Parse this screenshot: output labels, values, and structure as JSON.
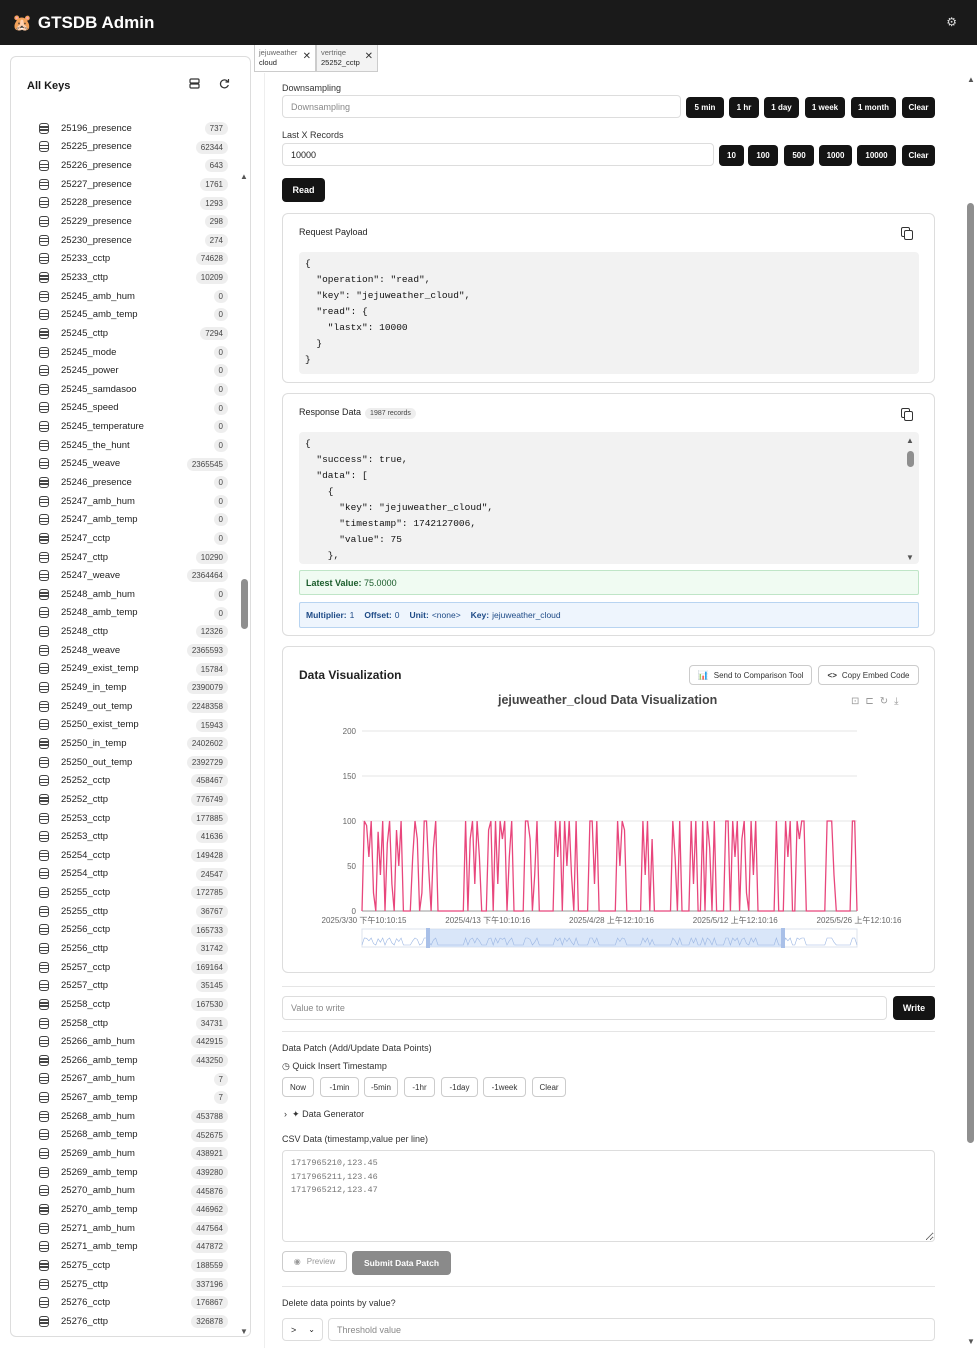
{
  "app": {
    "title": "GTSDB Admin",
    "logo_icon": "hamster-icon",
    "settings_icon": "gear-icon"
  },
  "sidebar": {
    "title": "All Keys",
    "top_partial": "25196_presence",
    "keys": [
      {
        "name": "25196_presence",
        "count": "737"
      },
      {
        "name": "25225_presence",
        "count": "62344"
      },
      {
        "name": "25226_presence",
        "count": "643"
      },
      {
        "name": "25227_presence",
        "count": "1761"
      },
      {
        "name": "25228_presence",
        "count": "1293"
      },
      {
        "name": "25229_presence",
        "count": "298"
      },
      {
        "name": "25230_presence",
        "count": "274"
      },
      {
        "name": "25233_cctp",
        "count": "74628"
      },
      {
        "name": "25233_cttp",
        "count": "10209"
      },
      {
        "name": "25245_amb_hum",
        "count": "0"
      },
      {
        "name": "25245_amb_temp",
        "count": "0"
      },
      {
        "name": "25245_cttp",
        "count": "7294"
      },
      {
        "name": "25245_mode",
        "count": "0"
      },
      {
        "name": "25245_power",
        "count": "0"
      },
      {
        "name": "25245_samdasoo",
        "count": "0"
      },
      {
        "name": "25245_speed",
        "count": "0"
      },
      {
        "name": "25245_temperature",
        "count": "0"
      },
      {
        "name": "25245_the_hunt",
        "count": "0"
      },
      {
        "name": "25245_weave",
        "count": "2365545"
      },
      {
        "name": "25246_presence",
        "count": "0"
      },
      {
        "name": "25247_amb_hum",
        "count": "0"
      },
      {
        "name": "25247_amb_temp",
        "count": "0"
      },
      {
        "name": "25247_cctp",
        "count": "0"
      },
      {
        "name": "25247_cttp",
        "count": "10290"
      },
      {
        "name": "25247_weave",
        "count": "2364464"
      },
      {
        "name": "25248_amb_hum",
        "count": "0"
      },
      {
        "name": "25248_amb_temp",
        "count": "0"
      },
      {
        "name": "25248_cttp",
        "count": "12326"
      },
      {
        "name": "25248_weave",
        "count": "2365593"
      },
      {
        "name": "25249_exist_temp",
        "count": "15784"
      },
      {
        "name": "25249_in_temp",
        "count": "2390079"
      },
      {
        "name": "25249_out_temp",
        "count": "2248358"
      },
      {
        "name": "25250_exist_temp",
        "count": "15943"
      },
      {
        "name": "25250_in_temp",
        "count": "2402602"
      },
      {
        "name": "25250_out_temp",
        "count": "2392729"
      },
      {
        "name": "25252_cctp",
        "count": "458467"
      },
      {
        "name": "25252_cttp",
        "count": "776749"
      },
      {
        "name": "25253_cctp",
        "count": "177885"
      },
      {
        "name": "25253_cttp",
        "count": "41636"
      },
      {
        "name": "25254_cctp",
        "count": "149428"
      },
      {
        "name": "25254_cttp",
        "count": "24547"
      },
      {
        "name": "25255_cctp",
        "count": "172785"
      },
      {
        "name": "25255_cttp",
        "count": "36767"
      },
      {
        "name": "25256_cctp",
        "count": "165733"
      },
      {
        "name": "25256_cttp",
        "count": "31742"
      },
      {
        "name": "25257_cctp",
        "count": "169164"
      },
      {
        "name": "25257_cttp",
        "count": "35145"
      },
      {
        "name": "25258_cctp",
        "count": "167530"
      },
      {
        "name": "25258_cttp",
        "count": "34731"
      },
      {
        "name": "25266_amb_hum",
        "count": "442915"
      },
      {
        "name": "25266_amb_temp",
        "count": "443250"
      },
      {
        "name": "25267_amb_hum",
        "count": "7"
      },
      {
        "name": "25267_amb_temp",
        "count": "7"
      },
      {
        "name": "25268_amb_hum",
        "count": "453788"
      },
      {
        "name": "25268_amb_temp",
        "count": "452675"
      },
      {
        "name": "25269_amb_hum",
        "count": "438921"
      },
      {
        "name": "25269_amb_temp",
        "count": "439280"
      },
      {
        "name": "25270_amb_hum",
        "count": "445876"
      },
      {
        "name": "25270_amb_temp",
        "count": "446962"
      },
      {
        "name": "25271_amb_hum",
        "count": "447564"
      },
      {
        "name": "25271_amb_temp",
        "count": "447872"
      },
      {
        "name": "25275_cctp",
        "count": "188559"
      },
      {
        "name": "25275_cttp",
        "count": "337196"
      },
      {
        "name": "25276_cctp",
        "count": "176867"
      },
      {
        "name": "25276_cttp",
        "count": "326878"
      }
    ]
  },
  "tabs": [
    {
      "line1": "jejuweather",
      "line2": "cloud",
      "close": "✕"
    },
    {
      "line1": "vertriqe",
      "line2": "25252_cctp",
      "close": "✕"
    }
  ],
  "downsampling": {
    "label": "Downsampling",
    "placeholder": "Downsampling",
    "buttons": [
      "5 min",
      "1 hr",
      "1 day",
      "1 week",
      "1 month",
      "Clear"
    ]
  },
  "lastx": {
    "label": "Last X Records",
    "value": "10000",
    "buttons": [
      "10",
      "100",
      "500",
      "1000",
      "10000",
      "Clear"
    ]
  },
  "read_button": "Read",
  "request": {
    "title": "Request Payload",
    "code": "{\n  \"operation\": \"read\",\n  \"key\": \"jejuweather_cloud\",\n  \"read\": {\n    \"lastx\": 10000\n  }\n}"
  },
  "response": {
    "title": "Response Data",
    "badge": "1987 records",
    "code": "{\n  \"success\": true,\n  \"data\": [\n    {\n      \"key\": \"jejuweather_cloud\",\n      \"timestamp\": 1742127006,\n      \"value\": 75\n    },",
    "latest_label": "Latest Value:",
    "latest_value": "75.0000",
    "multiplier_label": "Multiplier:",
    "multiplier_value": "1",
    "offset_label": "Offset:",
    "offset_value": "0",
    "unit_label": "Unit:",
    "unit_value": "<none>",
    "key_label": "Key:",
    "key_value": "jejuweather_cloud"
  },
  "viz": {
    "title": "Data Visualization",
    "send_button": "Send to Comparison Tool",
    "embed_button": "Copy Embed Code"
  },
  "chart_data": {
    "type": "line",
    "title": "jejuweather_cloud Data Visualization",
    "xlabel": "",
    "ylabel": "",
    "ylim": [
      0,
      200
    ],
    "yticks": [
      "0",
      "50",
      "100",
      "150",
      "200"
    ],
    "xticks": [
      "2025/3/30 下午10:10:15",
      "2025/4/13 下午10:10:16",
      "2025/4/28 上午12:10:16",
      "2025/5/12 上午12:10:16",
      "2025/5/26 上午12:10:16"
    ],
    "grid": true,
    "color": "#e8467c",
    "series": [
      {
        "values": [
          0,
          100,
          95,
          60,
          100,
          20,
          0,
          88,
          40,
          100,
          0,
          75,
          100,
          30,
          0,
          90,
          50,
          100,
          0,
          0,
          0,
          0,
          60,
          100,
          80,
          0,
          20,
          100,
          100,
          45,
          0,
          70,
          100,
          0,
          0,
          0,
          0,
          0,
          0,
          0,
          0,
          0,
          0,
          0,
          0,
          100,
          0,
          80,
          100,
          30,
          100,
          60,
          0,
          0,
          0,
          90,
          100,
          0,
          100,
          30,
          100,
          80,
          100,
          0,
          60,
          100,
          0,
          0,
          0,
          0,
          0,
          100,
          100,
          80,
          0,
          40,
          100,
          0,
          0,
          0,
          0,
          0,
          0,
          0,
          100,
          60,
          100,
          0,
          100,
          50,
          100,
          40,
          0,
          100,
          0,
          0,
          0,
          0,
          0,
          100,
          100,
          30,
          100,
          0,
          0,
          0,
          0,
          0,
          0,
          0,
          0,
          100,
          50,
          100,
          90,
          0,
          0,
          0,
          0,
          0,
          0,
          0,
          100,
          40,
          100,
          0,
          80,
          0,
          0,
          0,
          0,
          0,
          0,
          0,
          0,
          100,
          60,
          0,
          100,
          0,
          0,
          0,
          0,
          100,
          30,
          100,
          0,
          0,
          100,
          0,
          100,
          70,
          0,
          100,
          0,
          0,
          0,
          0,
          100,
          100,
          0,
          100,
          60,
          100,
          0,
          80,
          100,
          20,
          0,
          100,
          40,
          100,
          0,
          0,
          0,
          0,
          0,
          0,
          0,
          0,
          100,
          0,
          0,
          0,
          100,
          60,
          100,
          0,
          0,
          100,
          80,
          100,
          100,
          0,
          0,
          0,
          0,
          0,
          0,
          0,
          0,
          0,
          100,
          100,
          100,
          40,
          0,
          0,
          0,
          0,
          0,
          0,
          0,
          100,
          100,
          0
        ]
      }
    ]
  },
  "write": {
    "placeholder": "Value to write",
    "button": "Write"
  },
  "patch": {
    "title": "Data Patch (Add/Update Data Points)",
    "quick_label": "Quick Insert Timestamp",
    "quick_buttons": [
      "Now",
      "-1min",
      "-5min",
      "-1hr",
      "-1day",
      "-1week",
      "Clear"
    ],
    "generator": "Data Generator",
    "csv_label": "CSV Data (timestamp,value per line)",
    "csv_placeholder": "1717965210,123.45\n1717965211,123.46\n1717965212,123.47",
    "preview": "Preview",
    "submit": "Submit Data Patch"
  },
  "delete": {
    "title": "Delete data points by value?",
    "operator": ">",
    "placeholder": "Threshold value"
  }
}
